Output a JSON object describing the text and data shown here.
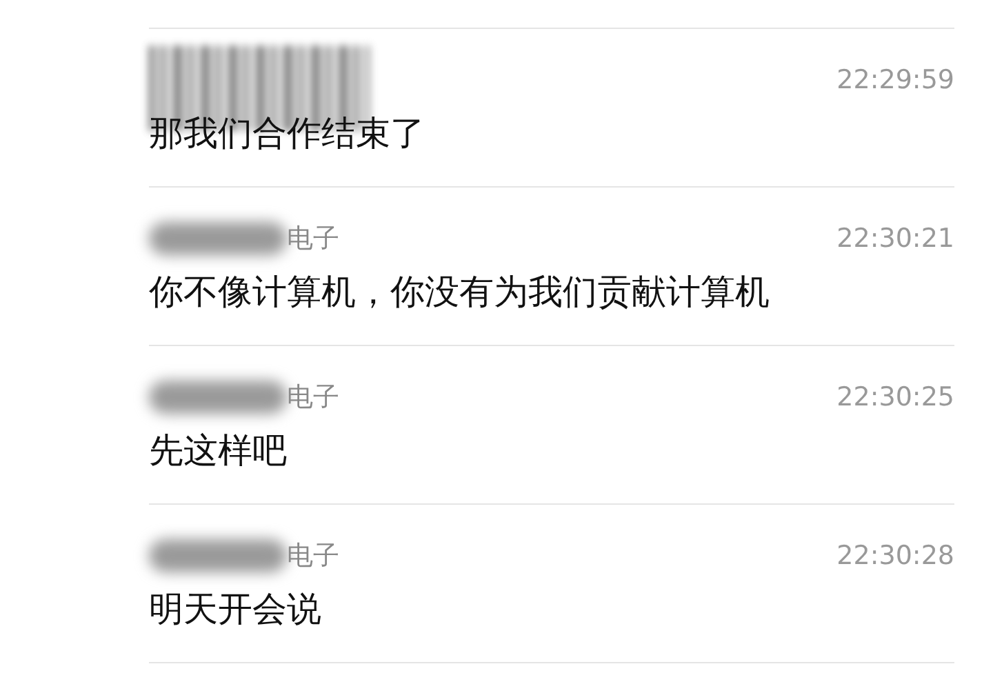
{
  "messages": [
    {
      "kind": "bars",
      "time": "22:29:59",
      "text": "那我们合作结束了"
    },
    {
      "kind": "smudge",
      "sender": "电子",
      "time": "22:30:21",
      "text": "你不像计算机，你没有为我们贡献计算机"
    },
    {
      "kind": "smudge",
      "sender": "电子",
      "time": "22:30:25",
      "text": "先这样吧"
    },
    {
      "kind": "smudge",
      "sender": "电子",
      "time": "22:30:28",
      "text": "明天开会说"
    }
  ]
}
